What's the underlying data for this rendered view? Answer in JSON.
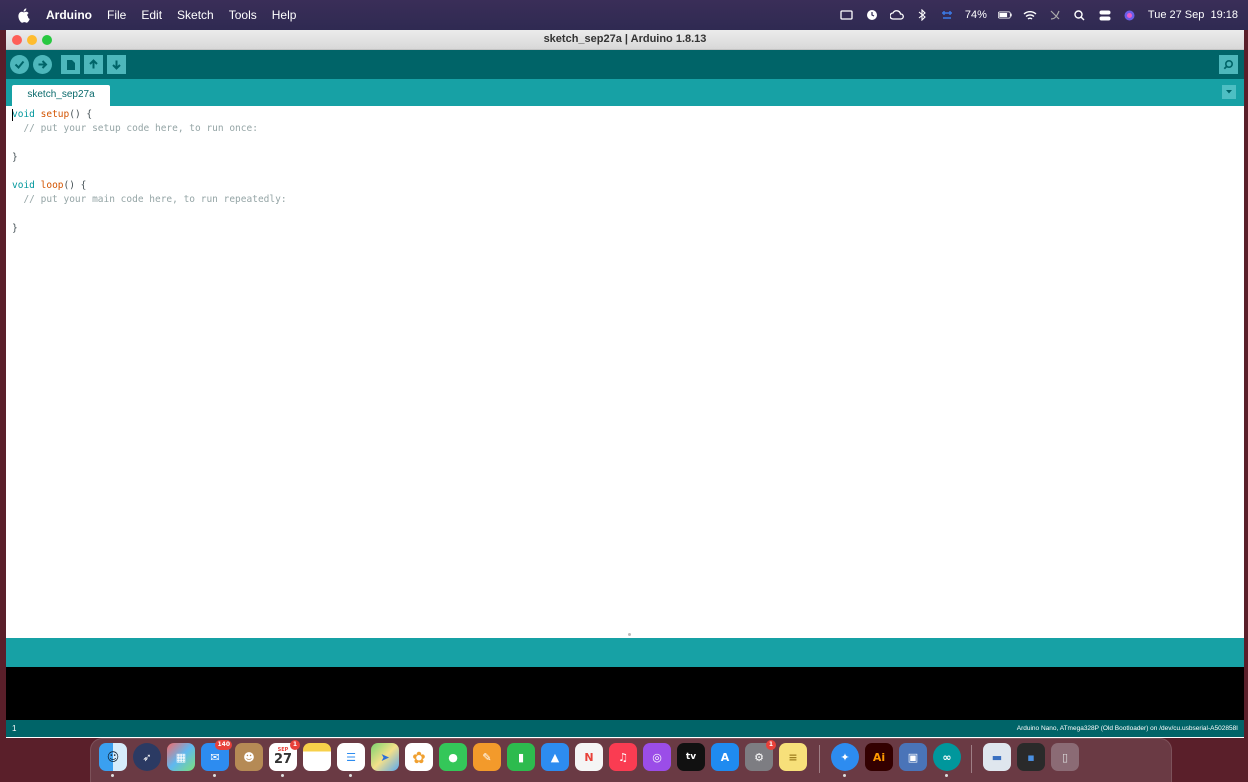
{
  "menubar": {
    "app_name": "Arduino",
    "menus": [
      "File",
      "Edit",
      "Sketch",
      "Tools",
      "Help"
    ],
    "battery": "74%",
    "datetime": "Tue 27 Sep  19:18"
  },
  "window": {
    "title": "sketch_sep27a | Arduino 1.8.13"
  },
  "tabs": [
    {
      "label": "sketch_sep27a"
    }
  ],
  "editor": {
    "lines": [
      "void setup() {",
      "  // put your setup code here, to run once:",
      "",
      "}",
      "",
      "void loop() {",
      "  // put your main code here, to run repeatedly:",
      "",
      "}"
    ]
  },
  "status": {
    "line_number": "1",
    "board": "Arduino Nano, ATmega328P (Old Bootloader) on /dev/cu.usbserial-A502858I"
  },
  "dock": {
    "calendar_month": "SEP",
    "calendar_day": "27",
    "mail_badge": "140",
    "calendar_badge": "1",
    "settings_badge": "1",
    "tv_label": "tv",
    "illustrator_label": "Ai"
  },
  "colors": {
    "arduino_dark_teal": "#006468",
    "arduino_teal": "#17a1a5",
    "keyword": "#00979c",
    "function": "#d35400",
    "comment": "#95a5a6"
  }
}
